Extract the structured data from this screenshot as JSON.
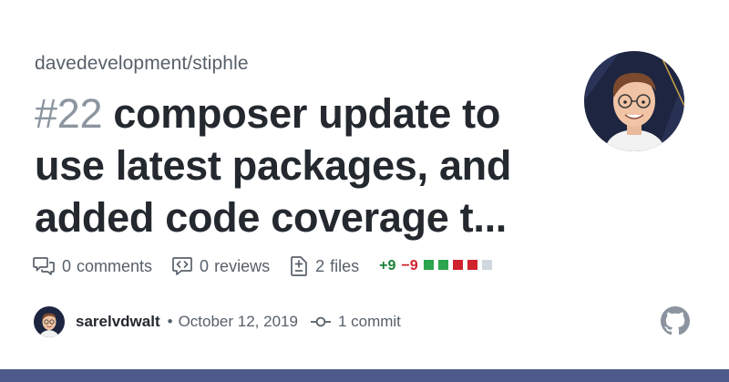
{
  "repo": "davedevelopment/stiphle",
  "pr": {
    "number": "#22",
    "title": "composer update to use latest packages, and added code coverage t..."
  },
  "stats": {
    "comments_count": "0",
    "comments_label": "comments",
    "reviews_count": "0",
    "reviews_label": "reviews",
    "files_count": "2",
    "files_label": "files",
    "additions": "+9",
    "deletions": "−9",
    "diff_blocks": [
      "green",
      "green",
      "red",
      "red",
      "gray"
    ]
  },
  "author": {
    "username": "sarelvdwalt",
    "separator": "•",
    "date": "October 12, 2019",
    "commits": "1 commit"
  },
  "colors": {
    "green": "#2da44e",
    "red": "#cf222e",
    "gray": "#d0d7de",
    "footer": "#4c5b8c"
  },
  "icons": [
    "comment-icon",
    "review-icon",
    "file-diff-icon",
    "commit-icon",
    "github-logo-icon"
  ]
}
